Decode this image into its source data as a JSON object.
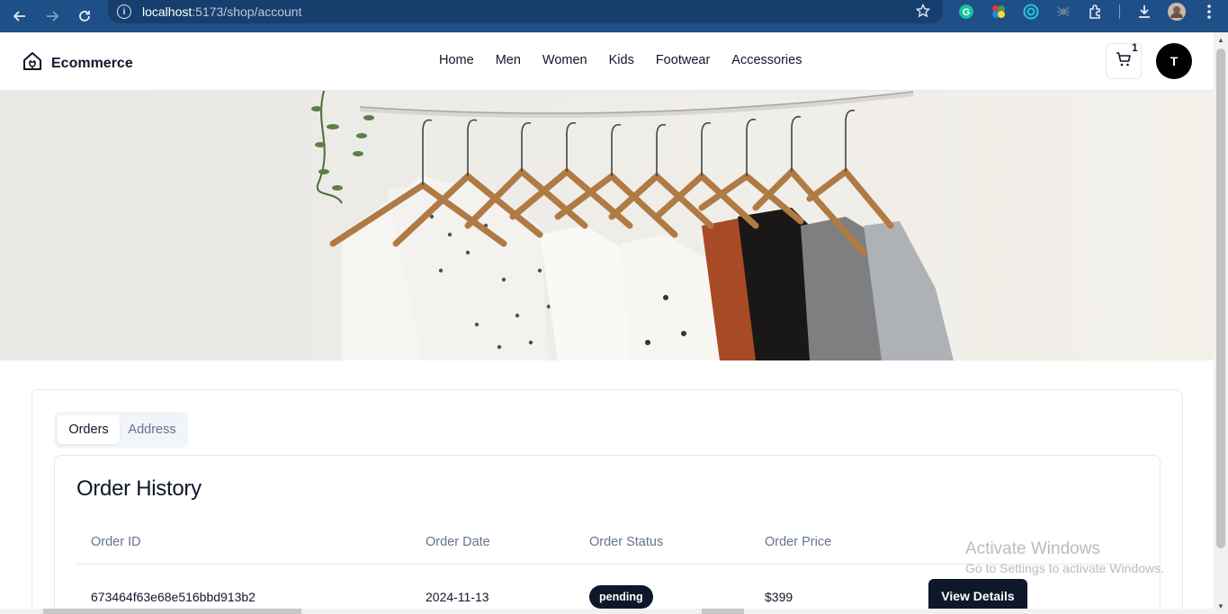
{
  "browser": {
    "url_host": "localhost",
    "url_rest": ":5173/shop/account"
  },
  "header": {
    "brand": "Ecommerce",
    "nav": [
      "Home",
      "Men",
      "Women",
      "Kids",
      "Footwear",
      "Accessories"
    ],
    "cart_count": "1",
    "avatar_initial": "T"
  },
  "account": {
    "tabs": [
      "Orders",
      "Address"
    ],
    "active_tab": "Orders",
    "section_title": "Order History",
    "columns": [
      "Order ID",
      "Order Date",
      "Order Status",
      "Order Price"
    ],
    "orders": [
      {
        "id": "673464f63e68e516bbd913b2",
        "date": "2024-11-13",
        "status": "pending",
        "price": "$399",
        "action": "View Details"
      }
    ]
  },
  "watermark": {
    "line1": "Activate Windows",
    "line2": "Go to Settings to activate Windows."
  },
  "colors": {
    "browser_bar": "#1e4f86",
    "primary_dark": "#0f172a",
    "muted_text": "#64748b",
    "border": "#e5e7eb"
  }
}
